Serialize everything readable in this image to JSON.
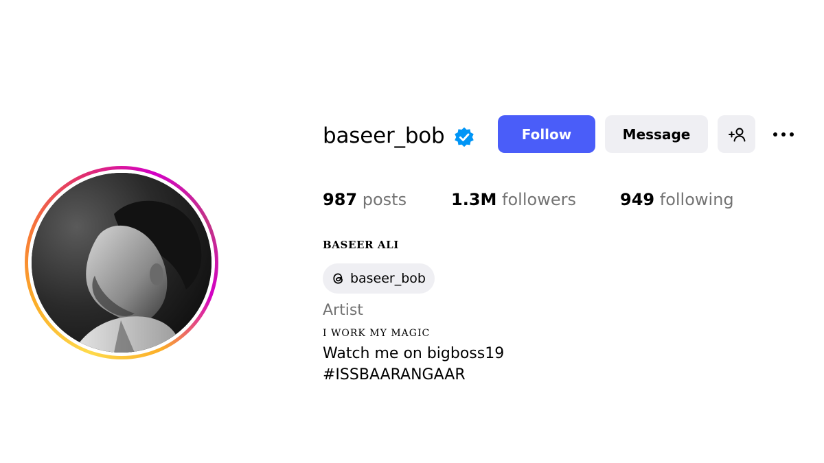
{
  "profile": {
    "username": "baseer_bob",
    "verified": true,
    "full_name": "BASEER ALI",
    "avatar": {
      "icon": "profile-photo",
      "story_ring": true
    }
  },
  "actions": {
    "follow_label": "Follow",
    "message_label": "Message",
    "add_user_icon": "add-user-icon",
    "more_icon": "more-options-icon"
  },
  "stats": {
    "posts": {
      "value": "987",
      "label": "posts"
    },
    "followers": {
      "value": "1.3M",
      "label": "followers"
    },
    "following": {
      "value": "949",
      "label": "following"
    }
  },
  "threads": {
    "icon": "threads-icon",
    "handle": "baseer_bob"
  },
  "bio": {
    "category": "Artist",
    "lines": [
      "I WORK MY MAGIC",
      "Watch me on bigboss19",
      "#ISSBAARANGAAR"
    ]
  },
  "colors": {
    "accent": "#4a5df9",
    "verified": "#0095f6",
    "secondary_button": "#efeff3",
    "muted_text": "#737373"
  }
}
